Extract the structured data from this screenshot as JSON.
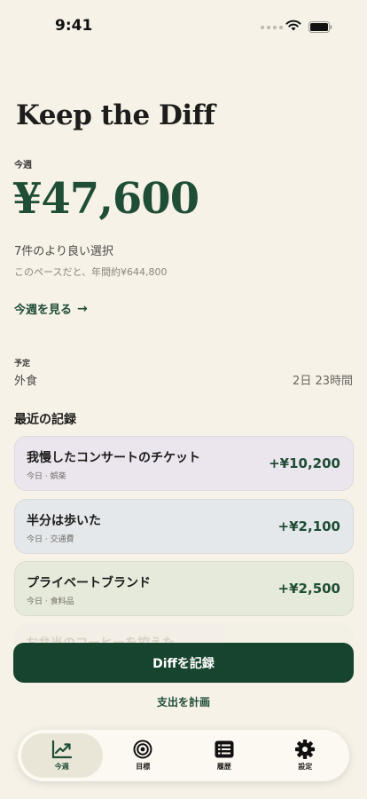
{
  "status_bar": {
    "time": "9:41"
  },
  "app": {
    "title": "Keep the Diff"
  },
  "summary": {
    "period_label": "今週",
    "total": "¥47,600",
    "choices": "7件のより良い選択",
    "pace": "このペースだと、年間約¥644,800",
    "see_week_link": "今週を見る"
  },
  "plan": {
    "label": "予定",
    "name": "外食",
    "remaining": "2日 23時間"
  },
  "recent": {
    "heading": "最近の記録",
    "records": [
      {
        "title": "我慢したコンサートのチケット",
        "meta": "今日 · 娯楽",
        "amount": "+¥10,200",
        "color": "#ebe5ee"
      },
      {
        "title": "半分は歩いた",
        "meta": "今日 · 交通費",
        "amount": "+¥2,100",
        "color": "#e4e8eb"
      },
      {
        "title": "プライベートブランド",
        "meta": "今日 · 食料品",
        "amount": "+¥2,500",
        "color": "#e6eadb"
      }
    ],
    "faded_title": "お弁当のコーヒーを控えた"
  },
  "actions": {
    "record_button": "Diffを記録",
    "plan_link": "支出を計画"
  },
  "tabs": [
    {
      "label": "今週",
      "icon": "trend-icon",
      "active": true
    },
    {
      "label": "目標",
      "icon": "target-icon",
      "active": false
    },
    {
      "label": "履歴",
      "icon": "history-icon",
      "active": false
    },
    {
      "label": "設定",
      "icon": "gear-icon",
      "active": false
    }
  ],
  "colors": {
    "accent": "#1f4d36",
    "button": "#17442e",
    "background": "#f6f2e8"
  }
}
